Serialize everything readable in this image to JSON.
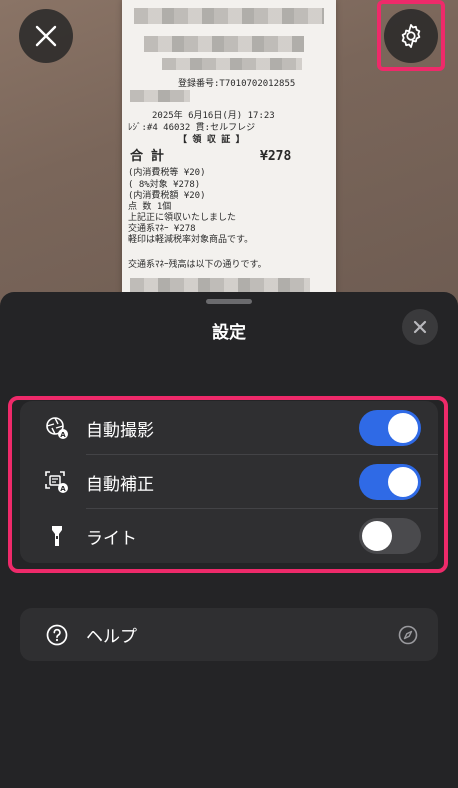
{
  "receipt": {
    "reg_no": "登録番号:T7010702012855",
    "datetime": "2025年 6月16日(月) 17:23",
    "register": "ﾚｼﾞ:#4 46032    貫:セルフレジ",
    "heading": "【 領 収 証 】",
    "total_label": "合  計",
    "total_value": "¥278",
    "tax_line1": "(内消費税等            ¥20)",
    "tax_line2": "  ( 8%対象            ¥278)",
    "tax_line3": "  (内消費税額          ¥20)",
    "count_line": "点      数             1個",
    "note1": "  上記正に領収いたしました",
    "payment": "交通系ﾏﾈｰ               ¥278",
    "note2": "軽印は軽減税率対象商品です。",
    "balance": "交通系ﾏﾈｰ残高は以下の通りです。"
  },
  "sheet": {
    "title": "設定"
  },
  "settings": [
    {
      "label": "自動撮影",
      "icon": "auto-capture-icon",
      "on": true
    },
    {
      "label": "自動補正",
      "icon": "auto-correct-icon",
      "on": true
    },
    {
      "label": "ライト",
      "icon": "flashlight-icon",
      "on": false
    }
  ],
  "help": {
    "label": "ヘルプ",
    "icon": "question-circle-icon",
    "trailing_icon": "compass-icon"
  },
  "colors": {
    "accent": "#2f6ae6",
    "highlight": "#ee2a6a",
    "sheet_bg": "#242426",
    "group_bg": "#2f2f31"
  }
}
